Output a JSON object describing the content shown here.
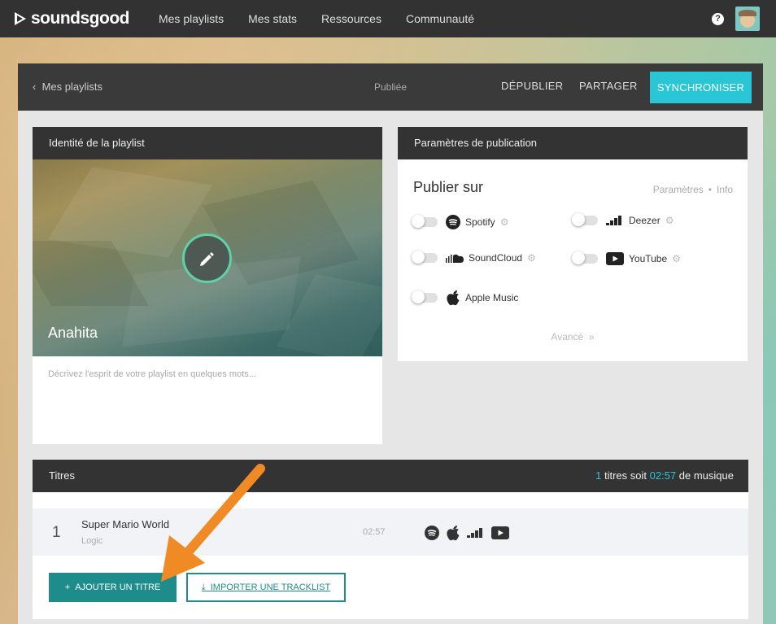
{
  "nav": {
    "logo": "soundsgood",
    "links": [
      "Mes playlists",
      "Mes stats",
      "Ressources",
      "Communauté"
    ],
    "help": "?"
  },
  "header": {
    "back_label": "Mes playlists",
    "status": "Publiée",
    "unpublish_label": "DÉPUBLIER",
    "share_label": "PARTAGER",
    "sync_label": "SYNCHRONISER",
    "accent_color": "#29c6d6"
  },
  "identity": {
    "heading": "Identité de la playlist",
    "playlist_name": "Anahita",
    "description_placeholder": "Décrivez l'esprit de votre playlist en quelques mots..."
  },
  "publication": {
    "heading": "Paramètres de publication",
    "title": "Publier sur",
    "settings_link": "Paramètres",
    "info_link": "Info",
    "services": [
      {
        "name": "Spotify",
        "icon": "spotify-icon",
        "enabled": false
      },
      {
        "name": "Deezer",
        "icon": "deezer-icon",
        "enabled": false
      },
      {
        "name": "SoundCloud",
        "icon": "soundcloud-icon",
        "enabled": false
      },
      {
        "name": "YouTube",
        "icon": "youtube-icon",
        "enabled": false
      },
      {
        "name": "Apple Music",
        "icon": "apple-icon",
        "enabled": false
      }
    ],
    "advanced_label": "Avancé"
  },
  "tracks": {
    "heading": "Titres",
    "count": "1",
    "count_suffix": " titres soit ",
    "total_duration": "02:57",
    "duration_suffix": " de musique",
    "items": [
      {
        "number": "1",
        "title": "Super Mario World",
        "artist": "Logic",
        "duration": "02:57"
      }
    ],
    "add_label": "AJOUTER UN TITRE",
    "import_label": "IMPORTER UNE TRACKLIST"
  }
}
